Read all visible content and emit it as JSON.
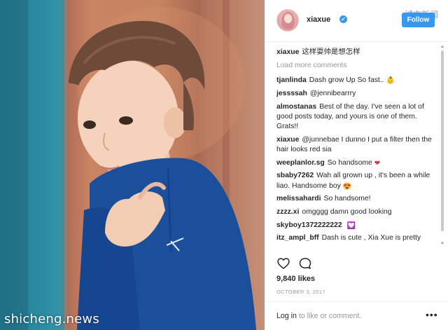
{
  "colors": {
    "accent": "#3897f0",
    "username_text": "#262626",
    "muted_text": "#999999",
    "heart_emoji": "#d6324a"
  },
  "photo": {
    "watermark": "shicheng.news"
  },
  "header": {
    "username": "xiaxue",
    "verified_icon": "verified-badge-icon",
    "follow_label": "Follow",
    "overlay_mark": "城市新闻"
  },
  "caption": {
    "user": "xiaxue",
    "text": "这样耍帅是想怎样"
  },
  "load_more": "Load more comments",
  "comments": [
    {
      "user": "tjanlinda",
      "text": "Dash grow Up So fast..",
      "emoji": "baby-face-emoji"
    },
    {
      "user": "jessssah",
      "text": "@jennibearrry"
    },
    {
      "user": "almostanas",
      "text": "Best of the day. I've seen a lot of good posts today, and yours is one of them. Grats!!"
    },
    {
      "user": "xiaxue",
      "text": "@junnebae I dunno I put a filter then the hair looks red sia"
    },
    {
      "user": "weeplanlor.sg",
      "text": "So handsome",
      "emoji": "heart-eyes-emoji"
    },
    {
      "user": "sbaby7262",
      "text": "Wah all grown up , it's been a while liao. Handsome boy",
      "emoji": "heart-eyes-emoji"
    },
    {
      "user": "melissahardi",
      "text": "So handsome!"
    },
    {
      "user": "zzzz.xi",
      "text": "omgggg damn good looking"
    },
    {
      "user": "skyboy1372222222",
      "text": "",
      "emoji": "heart-box-emoji"
    },
    {
      "user": "itz_ampl_bff",
      "text": "Dash is cute , Xia Xue is pretty"
    }
  ],
  "actions": {
    "like_icon": "heart-outline-icon",
    "comment_icon": "speech-bubble-icon"
  },
  "likes": "9,840 likes",
  "date": "OCTOBER 3, 2017",
  "footer": {
    "login_link": "Log in",
    "login_rest": " to like or comment.",
    "more_icon": "more-options-icon"
  }
}
